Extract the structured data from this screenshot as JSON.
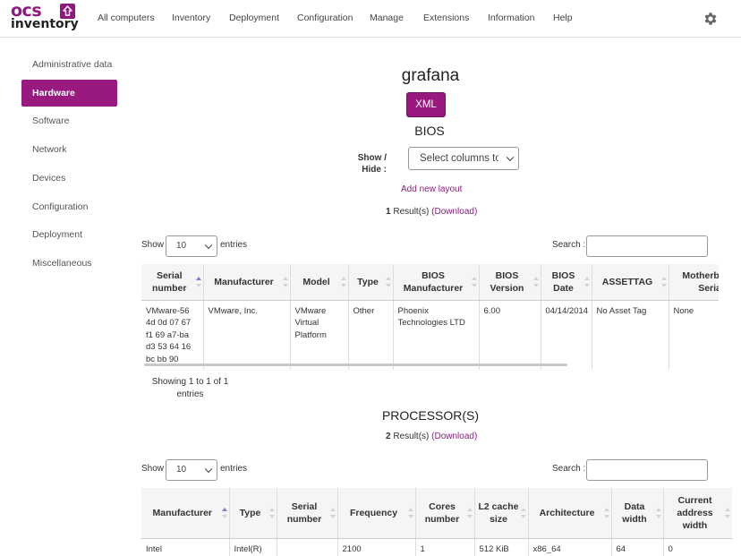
{
  "nav": {
    "items": [
      "All computers",
      "Inventory",
      "Deployment",
      "Configuration",
      "Manage",
      "Extensions",
      "Information",
      "Help"
    ]
  },
  "logo": {
    "top": "ocs",
    "bottom": "inventory"
  },
  "sidebar": {
    "items": [
      {
        "label": "Administrative data",
        "active": false
      },
      {
        "label": "Hardware",
        "active": true
      },
      {
        "label": "Software",
        "active": false
      },
      {
        "label": "Network",
        "active": false
      },
      {
        "label": "Devices",
        "active": false
      },
      {
        "label": "Configuration",
        "active": false
      },
      {
        "label": "Deployment",
        "active": false
      },
      {
        "label": "Miscellaneous",
        "active": false
      }
    ]
  },
  "main": {
    "computer_name": "grafana",
    "xml_label": "XML",
    "bios": {
      "title": "BIOS",
      "show_hide_line1": "Show /",
      "show_hide_line2": "Hide :",
      "columns_select": "Select columns to",
      "add_layout": "Add new layout",
      "result_count": "1",
      "result_text": "Result(s)",
      "download": "(Download)",
      "show_label": "Show",
      "entries_value": "10",
      "entries_label": "entries",
      "search_label": "Search :",
      "search_value": "",
      "info_line1": "Showing 1 to 1 of 1",
      "info_line2": "entries",
      "headers": [
        "Serial number",
        "Manufacturer",
        "Model",
        "Type",
        "BIOS Manufacturer",
        "BIOS Version",
        "BIOS Date",
        "ASSETTAG",
        "Motherboard Serial"
      ],
      "rows": [
        [
          "VMware-56 4d 0d 07 67 f1 69 a7-ba d3 53 64 16 bc bb 90",
          "VMware, Inc.",
          "VMware Virtual Platform",
          "Other",
          "Phoenix Technologies LTD",
          "6.00",
          "04/14/2014",
          "No Asset Tag",
          "None"
        ]
      ]
    },
    "processors": {
      "title": "PROCESSOR(S)",
      "result_count": "2",
      "result_text": "Result(s)",
      "download": "(Download)",
      "show_label": "Show",
      "entries_value": "10",
      "entries_label": "entries",
      "search_label": "Search :",
      "search_value": "",
      "headers": [
        "Manufacturer",
        "Type",
        "Serial number",
        "Frequency",
        "Cores number",
        "L2 cache size",
        "Architecture",
        "Data width",
        "Current address width"
      ],
      "rows": [
        [
          "Intel",
          "Intel(R)",
          "",
          "2100",
          "1",
          "512 KiB",
          "x86_64",
          "64",
          "0"
        ]
      ]
    }
  },
  "colors": {
    "accent": "#99197f",
    "link": "#8e1a7f"
  }
}
